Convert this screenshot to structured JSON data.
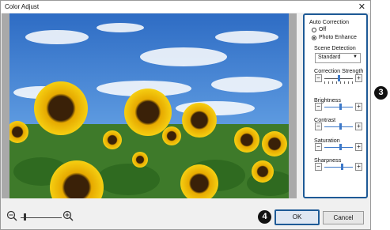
{
  "window": {
    "title": "Color Adjust",
    "close_glyph": "✕"
  },
  "panel": {
    "auto_correction_label": "Auto Correction",
    "options": [
      {
        "label": "Off",
        "selected": false
      },
      {
        "label": "Photo Enhance",
        "selected": true
      }
    ],
    "scene_detection_label": "Scene Detection",
    "scene_detection_value": "Standard",
    "sliders": [
      {
        "label": "Correction Strength",
        "level": 0.5
      },
      {
        "label": "Brightness",
        "level": 0.55
      },
      {
        "label": "Contrast",
        "level": 0.55
      },
      {
        "label": "Saturation",
        "level": 0.55
      },
      {
        "label": "Sharpness",
        "level": 0.6
      }
    ],
    "minus_glyph": "−",
    "plus_glyph": "+"
  },
  "callouts": {
    "panel": "3",
    "ok": "4"
  },
  "zoom": {
    "level": 0.1
  },
  "buttons": {
    "ok": "OK",
    "cancel": "Cancel"
  },
  "colors": {
    "accent_border": "#1e5a96",
    "slider_blue": "#3c78c8"
  }
}
